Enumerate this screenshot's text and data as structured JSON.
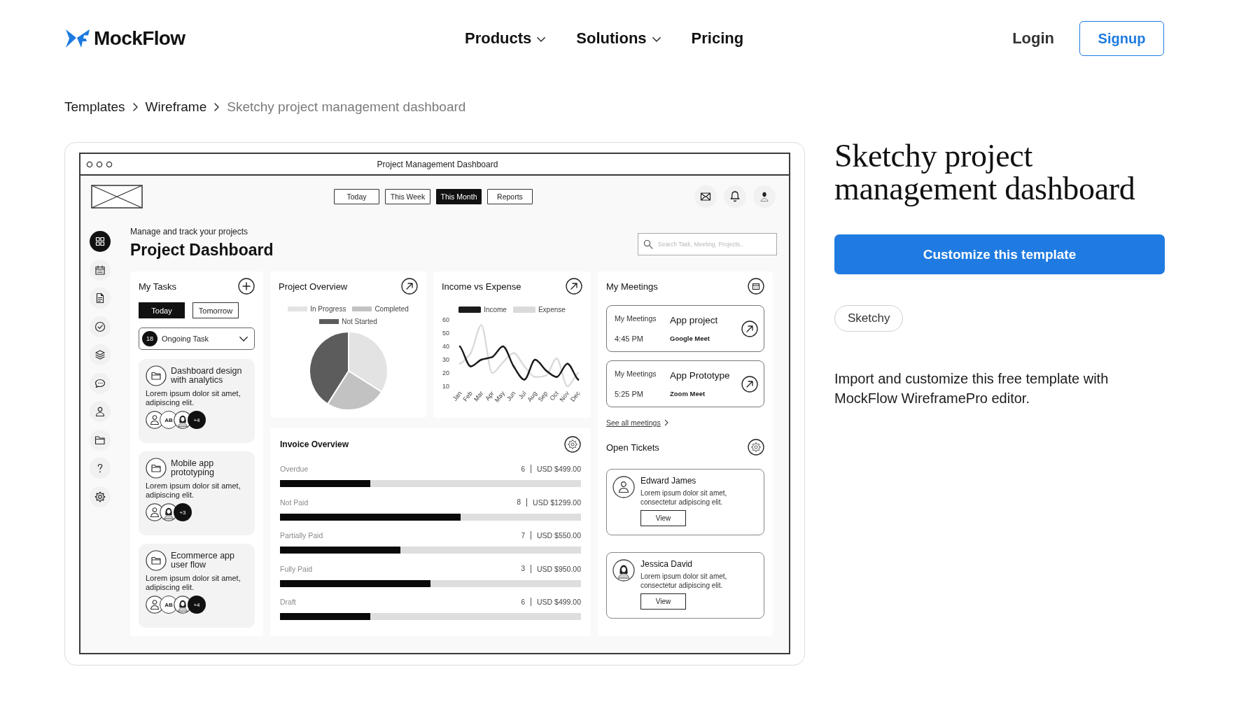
{
  "header": {
    "logo": "MockFlow",
    "nav": [
      {
        "label": "Products",
        "has_menu": true
      },
      {
        "label": "Solutions",
        "has_menu": true
      },
      {
        "label": "Pricing",
        "has_menu": false
      }
    ],
    "login": "Login",
    "signup": "Signup"
  },
  "breadcrumb": [
    {
      "label": "Templates",
      "current": false
    },
    {
      "label": "Wireframe",
      "current": false
    },
    {
      "label": "Sketchy project management dashboard",
      "current": true
    }
  ],
  "preview": {
    "window_title": "Project Management Dashboard",
    "period_tabs": [
      {
        "label": "Today",
        "selected": false
      },
      {
        "label": "This Week",
        "selected": false
      },
      {
        "label": "This Month",
        "selected": true
      },
      {
        "label": "Reports",
        "selected": false
      }
    ],
    "sidebar": [
      {
        "selected": true
      },
      {
        "selected": false
      },
      {
        "selected": false
      },
      {
        "selected": false
      },
      {
        "selected": false
      },
      {
        "selected": false
      },
      {
        "selected": false
      },
      {
        "selected": false
      },
      {
        "selected": false
      },
      {
        "selected": false
      }
    ],
    "subtitle": "Manage and track your projects",
    "title": "Project Dashboard",
    "search": {
      "placeholder": "Search Task, Meeting, Projects.."
    },
    "tasks": {
      "title": "My Tasks",
      "tabs": [
        {
          "label": "Today",
          "selected": true
        },
        {
          "label": "Tomorrow",
          "selected": false
        }
      ],
      "filter": {
        "count": "18",
        "label": "Ongoing Task"
      },
      "items": [
        {
          "title": "Dashboard design with analytics",
          "description": "Lorem ipsum dolor sit amet, adipiscing elit.",
          "avatars": [
            {
              "kind": "person"
            },
            {
              "kind": "initials",
              "text": "AB"
            },
            {
              "kind": "woman"
            },
            {
              "kind": "more",
              "text": "+4"
            }
          ]
        },
        {
          "title": "Mobile app prototyping",
          "description": "Lorem ipsum dolor sit amet, adipiscing elit.",
          "avatars": [
            {
              "kind": "person"
            },
            {
              "kind": "woman"
            },
            {
              "kind": "more",
              "text": "+3"
            }
          ]
        },
        {
          "title": "Ecommerce app user flow",
          "description": "Lorem ipsum dolor sit amet, adipiscing elit.",
          "avatars": [
            {
              "kind": "person"
            },
            {
              "kind": "initials",
              "text": "AB"
            },
            {
              "kind": "woman"
            },
            {
              "kind": "more",
              "text": "+4"
            }
          ]
        }
      ]
    },
    "project_overview": {
      "title": "Project Overview",
      "chart_data": {
        "type": "pie",
        "legend": "top",
        "categories": [
          "In Progress",
          "Completed",
          "Not Started"
        ],
        "values": [
          34,
          25,
          41
        ]
      }
    },
    "income_expense": {
      "title": "Income vs Expense",
      "chart_data": {
        "type": "line",
        "legend": "top",
        "x": [
          "Jan",
          "Feb",
          "Mar",
          "Apr",
          "May",
          "Jun",
          "Jul",
          "Aug",
          "Sep",
          "Oct",
          "Nov",
          "Dec"
        ],
        "ylim": [
          10,
          60
        ],
        "yticks": [
          10,
          20,
          30,
          40,
          50,
          60
        ],
        "series": [
          {
            "name": "Income",
            "color": "#1a1a1a",
            "values": [
              40,
              25,
              30,
              32,
              40,
              25,
              15,
              30,
              22,
              17,
              27,
              15
            ]
          },
          {
            "name": "Expense",
            "color": "#dadada",
            "values": [
              27,
              35,
              56,
              20,
              28,
              35,
              25,
              17,
              18,
              31,
              10,
              20
            ]
          }
        ]
      }
    },
    "meetings": {
      "title": "My Meetings",
      "items": [
        {
          "label": "My Meetings",
          "title": "App project",
          "time": "4:45 PM",
          "platform": "Google Meet"
        },
        {
          "label": "My Meetings",
          "title": "App Prototype",
          "time": "5:25 PM",
          "platform": "Zoom Meet"
        }
      ],
      "see_all": "See all meetings"
    },
    "tickets": {
      "title": "Open Tickets",
      "items": [
        {
          "kind": "person",
          "name": "Edward James",
          "text": "Lorem ipsum dolor sit amet, consectetur adipiscing elit.",
          "action": "View"
        },
        {
          "kind": "woman",
          "name": "Jessica David",
          "text": "Lorem ipsum dolor sit amet, consectetur adipiscing elit.",
          "action": "View"
        }
      ]
    },
    "invoice": {
      "title": "Invoice Overview",
      "rows": [
        {
          "label": "Overdue",
          "count": "6",
          "amount": "USD $499.00",
          "level": 0.3
        },
        {
          "label": "Not Paid",
          "count": "8",
          "amount": "USD $1299.00",
          "level": 0.6
        },
        {
          "label": "Partially Paid",
          "count": "7",
          "amount": "USD $550.00",
          "level": 0.4
        },
        {
          "label": "Fully Paid",
          "count": "3",
          "amount": "USD $950.00",
          "level": 0.5
        },
        {
          "label": "Draft",
          "count": "6",
          "amount": "USD $499.00",
          "level": 0.3
        }
      ]
    }
  },
  "details": {
    "title": "Sketchy project management dashboard",
    "cta": "Customize this template",
    "tags": [
      "Sketchy"
    ],
    "description": "Import and customize this free template with MockFlow WireframePro editor."
  }
}
